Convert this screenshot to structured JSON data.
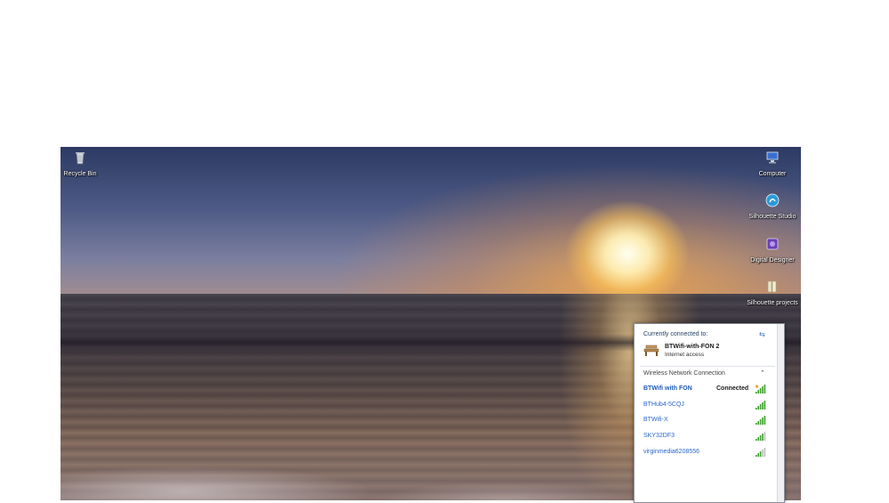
{
  "desktop": {
    "icons": [
      {
        "id": "recycle-bin",
        "label": "Recycle Bin",
        "icon": "recycle-bin-icon"
      },
      {
        "id": "computer",
        "label": "Computer",
        "icon": "computer-icon"
      },
      {
        "id": "silhouette-studio",
        "label": "Silhouette Studio",
        "icon": "silhouette-studio-icon"
      },
      {
        "id": "digital-designer",
        "label": "Digital Designer",
        "icon": "digital-designer-icon"
      },
      {
        "id": "silhouette-projects",
        "label": "Silhouette projects",
        "icon": "folder-icon"
      }
    ]
  },
  "network_flyout": {
    "currently_connected_label": "Currently connected to:",
    "connected": {
      "name": "BTWifi-with-FON  2",
      "access": "Internet access"
    },
    "section_title": "Wireless Network Connection",
    "networks": [
      {
        "name": "BTWifi with FON",
        "status": "Connected",
        "signal": 5,
        "shield": true
      },
      {
        "name": "BTHub4-5CQJ",
        "status": "",
        "signal": 5,
        "shield": false
      },
      {
        "name": "BTWifi-X",
        "status": "",
        "signal": 5,
        "shield": false
      },
      {
        "name": "SKY32DF3",
        "status": "",
        "signal": 4,
        "shield": false
      },
      {
        "name": "virginmedia6208556",
        "status": "",
        "signal": 3,
        "shield": false
      }
    ],
    "colors": {
      "link": "#2a66c8",
      "bars": "#3aa02a"
    }
  }
}
